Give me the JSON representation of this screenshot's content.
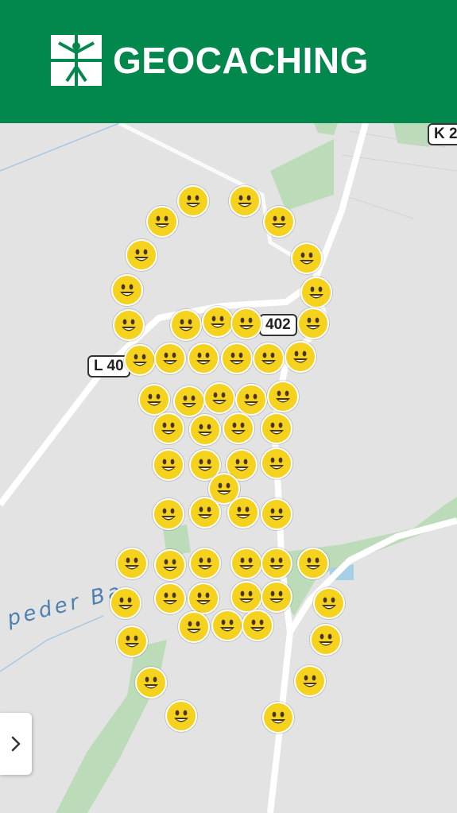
{
  "header": {
    "brand": "GEOCACHING",
    "logo_icon": "geocaching-logo-icon",
    "background_color": "#02874d"
  },
  "map": {
    "road_labels": [
      "K 2",
      "402",
      "L 40"
    ],
    "water_label": "peder Ba",
    "cache_icon": "smiley-face-icon",
    "cache_color": "#f4d21d"
  },
  "controls": {
    "expand_icon": "chevron-right-icon"
  }
}
